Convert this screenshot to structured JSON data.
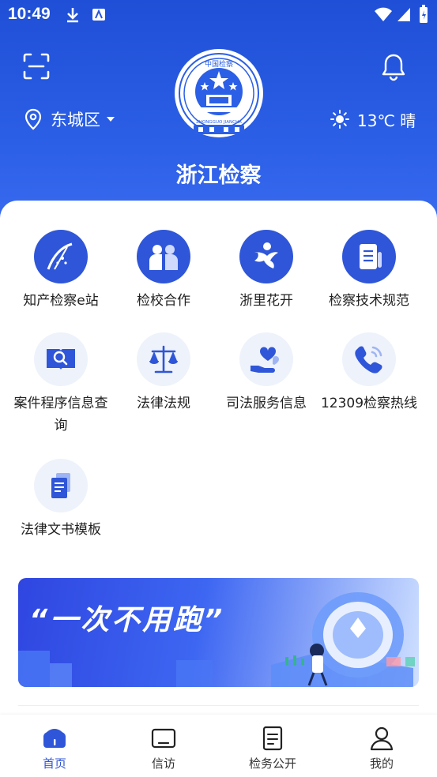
{
  "status_bar": {
    "time": "10:49"
  },
  "header": {
    "location": "东城区",
    "weather": "13℃ 晴",
    "title": "浙江检察",
    "emblem_ring_text": "ZHONGGUO JIANCHA",
    "emblem_top_text": "中国检察"
  },
  "services": [
    {
      "label": "知产检察e站",
      "icon": "ip-station-icon"
    },
    {
      "label": "检校合作",
      "icon": "cooperation-icon"
    },
    {
      "label": "浙里花开",
      "icon": "flower-icon"
    },
    {
      "label": "检察技术规范",
      "icon": "document-spec-icon"
    },
    {
      "label": "案件程序信息查询",
      "icon": "search-book-icon"
    },
    {
      "label": "法律法规",
      "icon": "scales-icon"
    },
    {
      "label": "司法服务信息",
      "icon": "heart-hand-icon"
    },
    {
      "label": "12309检察热线",
      "icon": "phone-icon"
    },
    {
      "label": "法律文书模板",
      "icon": "document-template-icon"
    }
  ],
  "banner": {
    "text": "“一次不用跑”"
  },
  "tabs": [
    {
      "label": "首页",
      "icon": "home-icon",
      "active": true
    },
    {
      "label": "信访",
      "icon": "letter-icon",
      "active": false
    },
    {
      "label": "检务公开",
      "icon": "file-icon",
      "active": false
    },
    {
      "label": "我的",
      "icon": "user-icon",
      "active": false
    }
  ],
  "colors": {
    "primary": "#2f56d8",
    "header": "#2b5fe6"
  }
}
